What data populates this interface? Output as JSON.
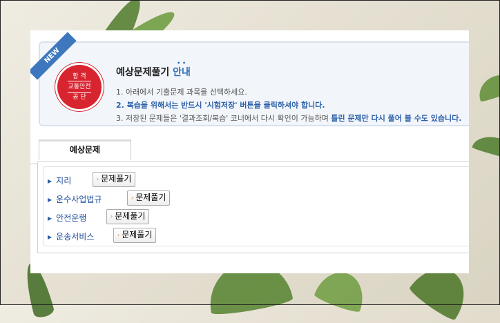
{
  "banner": {
    "ribbon": "NEW",
    "badge": {
      "line1": "합 격",
      "line2": "교통안전",
      "line3": "공 단"
    },
    "title_main": "예상문제풀기 ",
    "title_accent": "안내",
    "line1": "1. 아래에서 기출문제 과목을 선택하세요.",
    "line2": "2. 복습을 위해서는 반드시 '시험저장' 버튼을 클릭하셔야 합니다.",
    "line3_prefix": "3. 저장된 문제들은 '결과조회/복습' 코너에서 다시 확인이 가능하며 ",
    "line3_bold": "틀린 문제만 다시 풀어 볼 수도 있습니다."
  },
  "tab": {
    "label": "예상문제"
  },
  "subjects": [
    {
      "label": "지리",
      "button": "문제풀기"
    },
    {
      "label": "운수사업법규",
      "button": "문제풀기"
    },
    {
      "label": "안전운행",
      "button": "문제풀기"
    },
    {
      "label": "운송서비스",
      "button": "문제풀기"
    }
  ],
  "icons": {
    "bullet": "triangle-right-icon",
    "button_arrow": "arrow-right-icon"
  },
  "colors": {
    "accent": "#2c6fb6",
    "badge": "#d8242f",
    "ribbon": "#3e77bd"
  }
}
